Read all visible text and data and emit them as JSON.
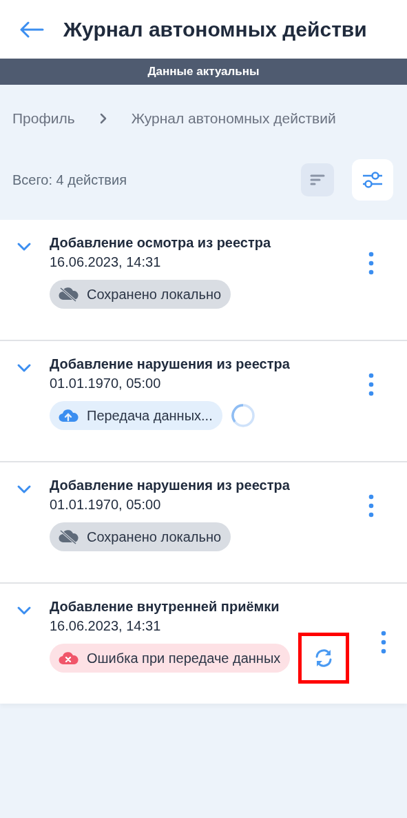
{
  "header": {
    "title": "Журнал автономных действи"
  },
  "status_bar": {
    "text": "Данные актуальны"
  },
  "breadcrumbs": [
    {
      "label": "Профиль"
    },
    {
      "label": "Журнал автономных действий"
    }
  ],
  "summary": {
    "count_text": "Всего: 4 действия"
  },
  "actions": [
    {
      "title": "Добавление осмотра из реестра",
      "date": "16.06.2023, 14:31",
      "status": {
        "kind": "local",
        "label": "Сохранено локально"
      },
      "expanded": false
    },
    {
      "title": "Добавление нарушения из реестра",
      "date": "01.01.1970, 05:00",
      "status": {
        "kind": "uploading",
        "label": "Передача данных..."
      },
      "expanded": false
    },
    {
      "title": "Добавление нарушения из реестра",
      "date": "01.01.1970, 05:00",
      "status": {
        "kind": "local",
        "label": "Сохранено локально"
      },
      "expanded": false
    },
    {
      "title": "Добавление внутренней приёмки",
      "date": "16.06.2023, 14:31",
      "status": {
        "kind": "error",
        "label": "Ошибка при передаче данных"
      },
      "expanded": false,
      "retry_highlighted": true
    }
  ]
}
